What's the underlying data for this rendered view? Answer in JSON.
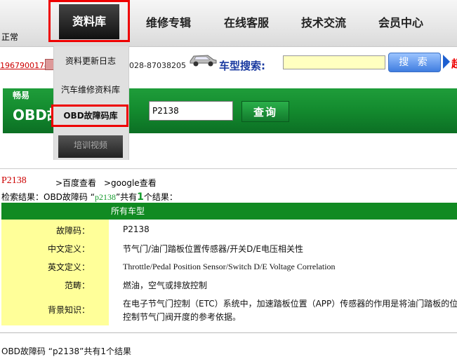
{
  "status": {
    "text": "正常"
  },
  "nav": {
    "active": "资料库",
    "items": [
      "维修专辑",
      "在线客服",
      "技术交流",
      "会员中心"
    ]
  },
  "header": {
    "phone1": "1967900174",
    "phone2": "028-87038205",
    "search_label": "车型搜索:",
    "search_value": "",
    "search_button": "搜 索",
    "red_edge": "超"
  },
  "dropdown": {
    "items": [
      "资料更新日志",
      "汽车维修资料库",
      "OBD故障码库",
      "培训视频"
    ]
  },
  "band": {
    "top_text": "畅易",
    "title": "OBD故",
    "code_value": "P2138",
    "query_button": "查询"
  },
  "results": {
    "code": "P2138",
    "baidu": ">百度查看",
    "google": ">google查看",
    "summary_prefix": "检索结果：OBD故障码 “",
    "summary_keyword": "p2138",
    "summary_mid": "”共有",
    "summary_count": "1",
    "summary_suffix": "个结果：",
    "table_header": "所有车型",
    "rows": [
      {
        "label": "故障码：",
        "value": "P2138"
      },
      {
        "label": "中文定义：",
        "value": "节气门/油门踏板位置传感器/开关D/E电压相关性"
      },
      {
        "label": "英文定义：",
        "value": "Throttle/Pedal Position Sensor/Switch D/E Voltage Correlation"
      },
      {
        "label": "范畴：",
        "value": "燃油，空气或排放控制"
      },
      {
        "label": "背景知识：",
        "value": "在电子节气门控制（ETC）系统中，加速踏板位置（APP）传感器的作用是将油门踏板的位"
      },
      {
        "label": "",
        "value": "控制节气门阀开度的参考依据。"
      }
    ],
    "bottom": "OBD故障码 “p2138”共有1个结果"
  }
}
